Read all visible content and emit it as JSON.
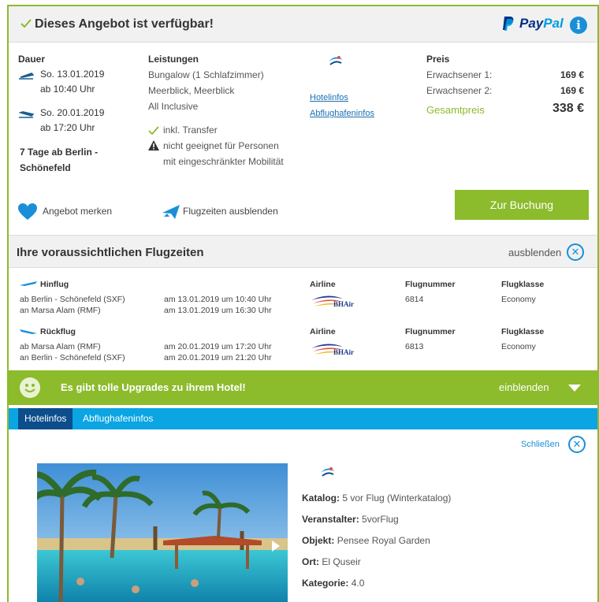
{
  "header": {
    "availability": "Dieses Angebot ist verfügbar!",
    "payment_provider_a": "Pay",
    "payment_provider_b": "Pal",
    "info_glyph": "i"
  },
  "offer": {
    "duration_label": "Dauer",
    "outbound_date": "So. 13.01.2019",
    "outbound_time": "ab 10:40 Uhr",
    "return_date": "So. 20.01.2019",
    "return_time": "ab 17:20 Uhr",
    "trip_summary_1": "7 Tage ab Berlin -",
    "trip_summary_2": "Schönefeld",
    "services_label": "Leistungen",
    "room": "Bungalow (1 Schlafzimmer)",
    "view": "Meerblick, Meerblick",
    "board": "All Inclusive",
    "transfer": "inkl. Transfer",
    "mobility_note_1": "nicht geeignet für Personen",
    "mobility_note_2": "mit eingeschränkter Mobilität",
    "hotel_info_link": "Hotelinfos",
    "airport_info_link": "Abflughafeninfos",
    "price_label": "Preis",
    "adult1_label": "Erwachsener 1:",
    "adult1_price": "169 €",
    "adult2_label": "Erwachsener 2:",
    "adult2_price": "169 €",
    "total_label": "Gesamtpreis",
    "total_price": "338 €",
    "remember": "Angebot merken",
    "hide_flight_times": "Flugzeiten ausblenden",
    "book_button": "Zur Buchung"
  },
  "flights": {
    "section_title": "Ihre voraussichtlichen Flugzeiten",
    "hide_label": "ausblenden",
    "close_glyph": "✕",
    "airline_header": "Airline",
    "flight_no_header": "Flugnummer",
    "class_header": "Flugklasse",
    "airline_name": "BHAir",
    "outbound": {
      "label": "Hinflug",
      "from": "ab Berlin - Schönefeld (SXF)",
      "to": "an Marsa Alam (RMF)",
      "dep": "am 13.01.2019 um 10:40 Uhr",
      "arr": "am 13.01.2019 um 16:30 Uhr",
      "number": "6814",
      "class": "Economy"
    },
    "return": {
      "label": "Rückflug",
      "from": "ab Marsa Alam (RMF)",
      "to": "an Berlin - Schönefeld (SXF)",
      "dep": "am 20.01.2019 um 17:20 Uhr",
      "arr": "am 20.01.2019 um 21:20 Uhr",
      "number": "6813",
      "class": "Economy"
    }
  },
  "upgrade": {
    "text": "Es gibt tolle Upgrades zu ihrem Hotel!",
    "action": "einblenden"
  },
  "tabs": [
    "Hotelinfos",
    "Abflughafeninfos"
  ],
  "hotel": {
    "close_label": "Schließen",
    "catalog_key": "Katalog:",
    "catalog_val": "5 vor Flug (Winterkatalog)",
    "operator_key": "Veranstalter:",
    "operator_val": "5vorFlug",
    "object_key": "Objekt:",
    "object_val": "Pensee Royal Garden",
    "place_key": "Ort:",
    "place_val": "El Quseir",
    "category_key": "Kategorie:",
    "category_val": "4.0"
  },
  "colors": {
    "accent_green": "#8cbb2c",
    "accent_blue": "#1a8fd8",
    "tab_bar": "#0aa5e2",
    "tab_active": "#0c4d8c"
  }
}
